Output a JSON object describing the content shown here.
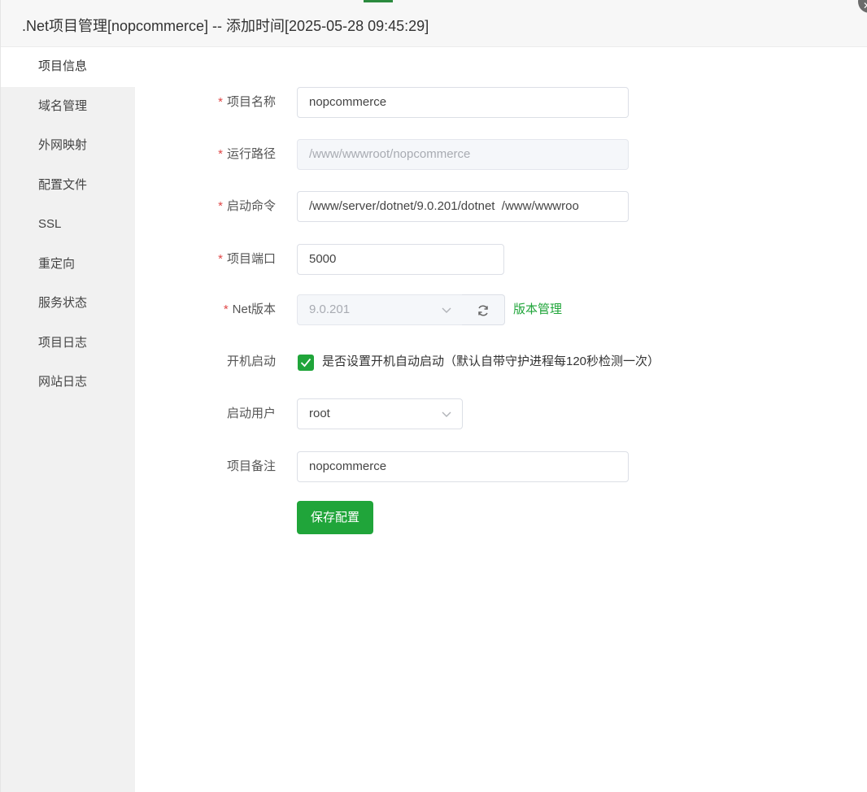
{
  "window": {
    "title": ".Net项目管理[nopcommerce] -- 添加时间[2025-05-28 09:45:29]",
    "close_icon": "close-icon"
  },
  "sidebar": {
    "items": [
      {
        "label": "项目信息",
        "active": true
      },
      {
        "label": "域名管理"
      },
      {
        "label": "外网映射"
      },
      {
        "label": "配置文件"
      },
      {
        "label": "SSL"
      },
      {
        "label": "重定向"
      },
      {
        "label": "服务状态"
      },
      {
        "label": "项目日志"
      },
      {
        "label": "网站日志"
      }
    ]
  },
  "form": {
    "required_mark": "*",
    "project_name": {
      "label": "项目名称",
      "value": "nopcommerce"
    },
    "run_path": {
      "label": "运行路径",
      "value": "/www/wwwroot/nopcommerce"
    },
    "start_command": {
      "label": "启动命令",
      "value": "/www/server/dotnet/9.0.201/dotnet  /www/wwwroo"
    },
    "project_port": {
      "label": "项目端口",
      "value": "5000"
    },
    "net_version": {
      "label": "Net版本",
      "value": "9.0.201",
      "link": "版本管理"
    },
    "autostart": {
      "label": "开机启动",
      "checked": true,
      "text": "是否设置开机自动启动（默认自带守护进程每120秒检测一次）"
    },
    "start_user": {
      "label": "启动用户",
      "value": "root"
    },
    "project_note": {
      "label": "项目备注",
      "value": "nopcommerce"
    },
    "save_label": "保存配置"
  },
  "colors": {
    "accent": "#20a53a",
    "required": "#e04848",
    "sidebar_bg": "#f1f1f1"
  }
}
